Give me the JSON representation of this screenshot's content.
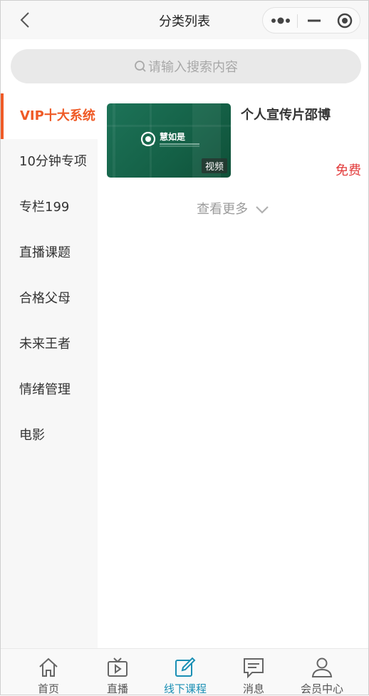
{
  "navbar": {
    "title": "分类列表",
    "back_icon": "chevron-left-icon",
    "capsule": {
      "more_icon": "more-dots-icon",
      "minimize_icon": "minimize-icon",
      "close_icon": "target-close-icon"
    }
  },
  "search": {
    "placeholder": "请输入搜索内容",
    "icon": "search-icon"
  },
  "sidebar": {
    "items": [
      {
        "label": "VIP十大系统",
        "active": true
      },
      {
        "label": "10分钟专项",
        "active": false
      },
      {
        "label": "专栏199",
        "active": false
      },
      {
        "label": "直播课题",
        "active": false
      },
      {
        "label": "合格父母",
        "active": false
      },
      {
        "label": "未来王者",
        "active": false
      },
      {
        "label": "情绪管理",
        "active": false
      },
      {
        "label": "电影",
        "active": false
      }
    ]
  },
  "content": {
    "courses": [
      {
        "title": "个人宣传片邵博",
        "price": "免费",
        "badge": "视频",
        "thumb_logo": "慧如是"
      }
    ],
    "see_more": "查看更多"
  },
  "tabbar": {
    "items": [
      {
        "label": "首页",
        "icon": "home-icon",
        "active": false
      },
      {
        "label": "直播",
        "icon": "tv-icon",
        "active": false
      },
      {
        "label": "线下课程",
        "icon": "edit-icon",
        "active": true
      },
      {
        "label": "消息",
        "icon": "message-icon",
        "active": false
      },
      {
        "label": "会员中心",
        "icon": "user-icon",
        "active": false
      }
    ]
  },
  "colors": {
    "accent": "#ef5a26",
    "price": "#e23b3b",
    "tab_active": "#1a8fb4",
    "thumb": "#146046"
  }
}
